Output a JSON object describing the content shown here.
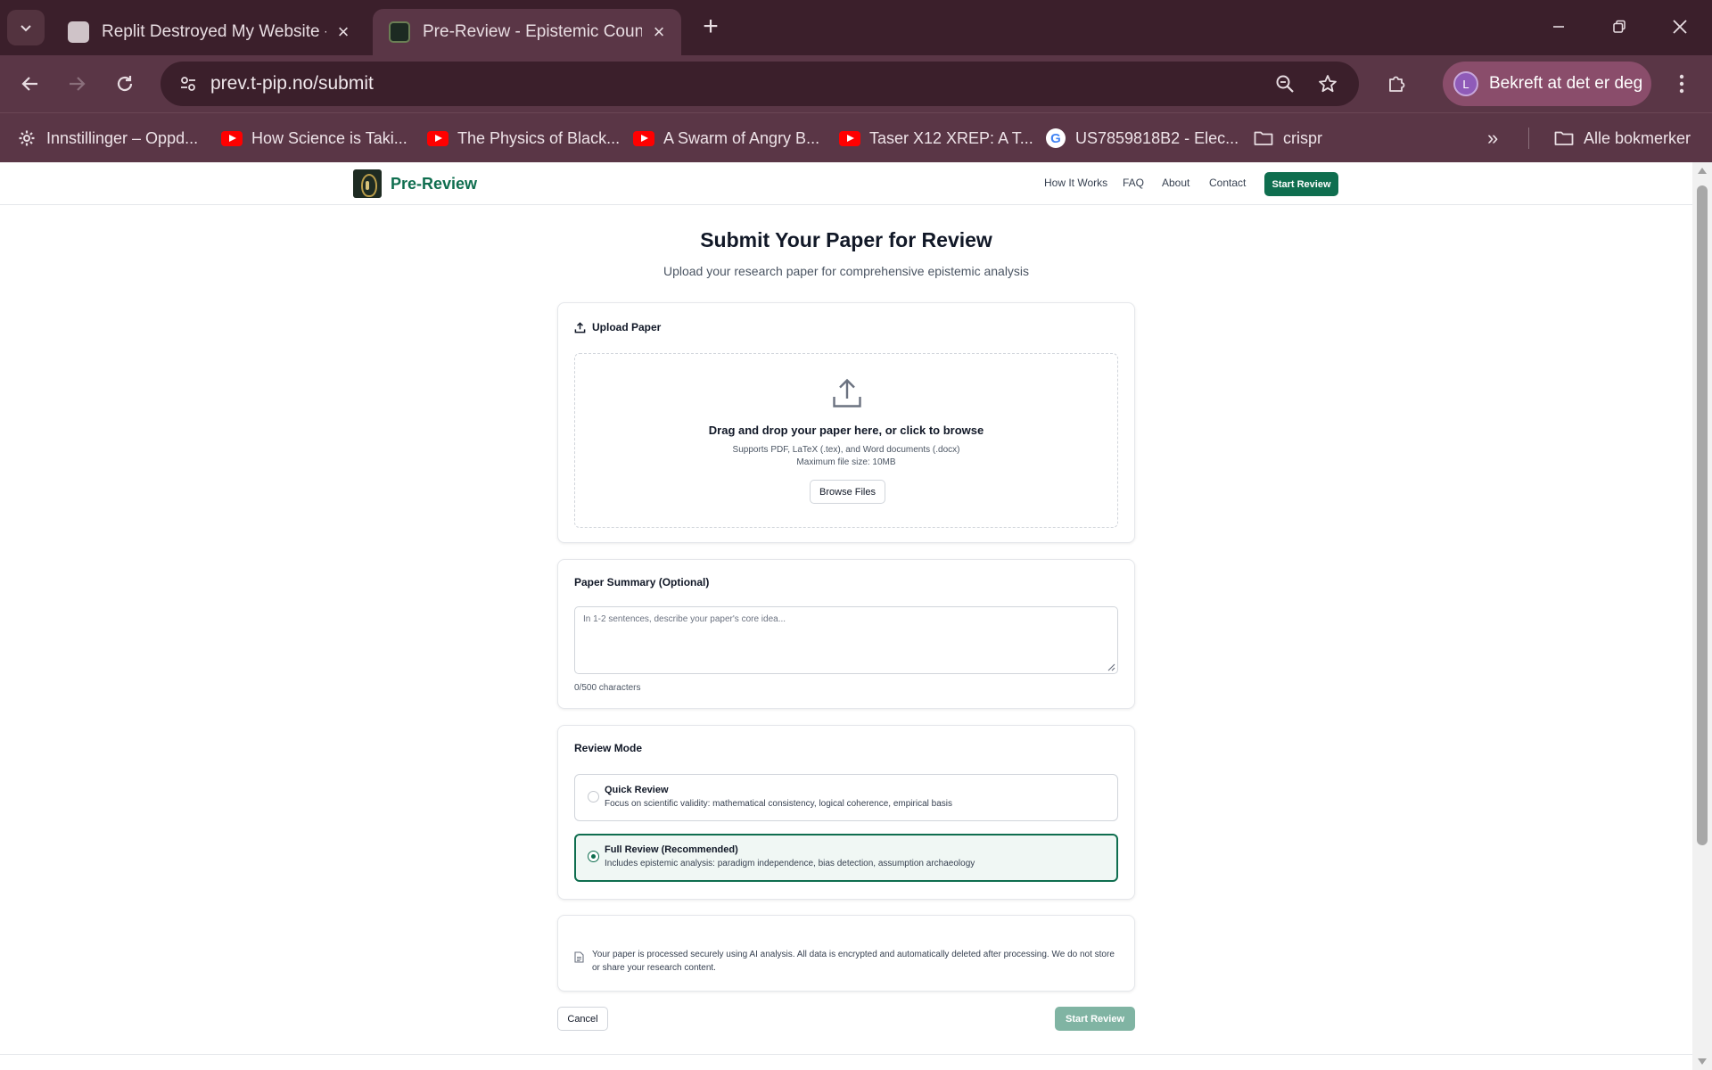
{
  "browser": {
    "tabs": [
      {
        "title": "Replit Destroyed My Website - Replit",
        "active": false
      },
      {
        "title": "Pre-Review - Epistemic Counter-Analysis",
        "active": true
      }
    ],
    "url": "prev.t-pip.no/submit",
    "profile_label": "Bekreft at det er deg",
    "profile_initial": "L",
    "bookmarks": [
      {
        "label": "Innstillinger – Oppd...",
        "icon": "gear-icon"
      },
      {
        "label": "How Science is Taki...",
        "icon": "youtube-icon"
      },
      {
        "label": "The Physics of Black...",
        "icon": "youtube-icon"
      },
      {
        "label": "A Swarm of Angry B...",
        "icon": "youtube-icon"
      },
      {
        "label": "Taser X12 XREP: A T...",
        "icon": "youtube-icon"
      },
      {
        "label": "US7859818B2 - Elec...",
        "icon": "google-icon"
      },
      {
        "label": "crispr",
        "icon": "folder-icon"
      }
    ],
    "all_bookmarks_label": "Alle bokmerker",
    "colors": {
      "frame": "#3b1f2b",
      "toolbar": "#5a3646",
      "profile_chip": "#8a4d6b"
    }
  },
  "site": {
    "brand": "Pre-Review",
    "nav": {
      "how_it_works": "How It Works",
      "faq": "FAQ",
      "about": "About",
      "contact": "Contact",
      "start_review": "Start Review"
    },
    "accent_color": "#0f6e4f"
  },
  "main": {
    "title": "Submit Your Paper for Review",
    "subtitle": "Upload your research paper for comprehensive epistemic analysis",
    "upload": {
      "card_title": "Upload Paper",
      "dropzone_title": "Drag and drop your paper here, or click to browse",
      "supports": "Supports PDF, LaTeX (.tex), and Word documents (.docx)",
      "max_size": "Maximum file size: 10MB",
      "browse_button": "Browse Files"
    },
    "summary": {
      "card_title": "Paper Summary (Optional)",
      "placeholder": "In 1-2 sentences, describe your paper's core idea...",
      "value": "",
      "char_count": "0/500 characters"
    },
    "review_mode": {
      "card_title": "Review Mode",
      "selected": "full",
      "options": [
        {
          "id": "quick",
          "title": "Quick Review",
          "desc": "Focus on scientific validity: mathematical consistency, logical coherence, empirical basis"
        },
        {
          "id": "full",
          "title": "Full Review (Recommended)",
          "desc": "Includes epistemic analysis: paradigm independence, bias detection, assumption archaeology"
        }
      ]
    },
    "privacy_notice": "Your paper is processed securely using AI analysis. All data is encrypted and automatically deleted after processing. We do not store or share your research content.",
    "actions": {
      "cancel": "Cancel",
      "start_review": "Start Review",
      "start_review_enabled": false
    }
  }
}
